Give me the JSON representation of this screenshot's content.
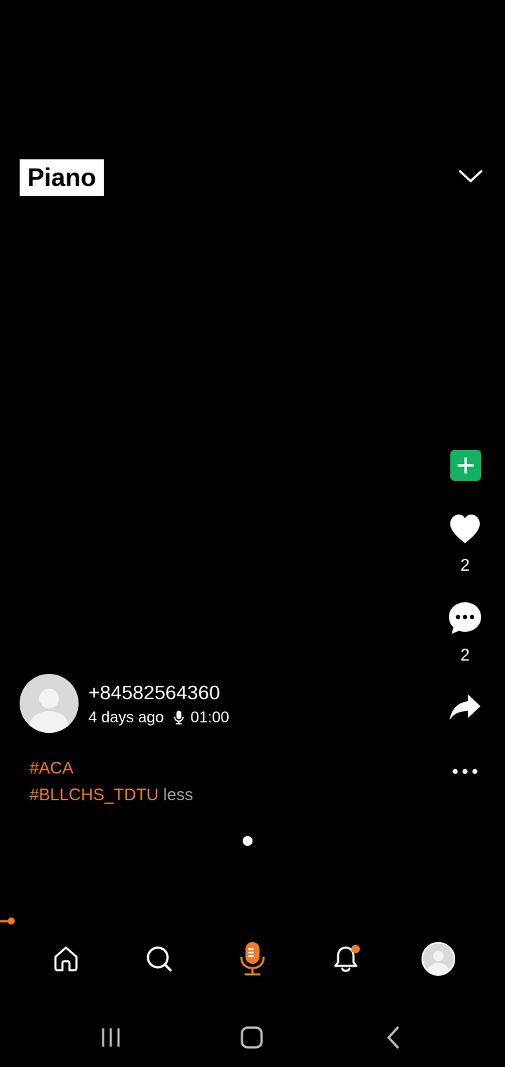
{
  "post": {
    "title": "Piano",
    "author": "+84582564360",
    "posted_ago": "4 days ago",
    "duration": "01:00",
    "tags": [
      "#ACA",
      "#BLLCHS_TDTU"
    ],
    "less_label": "less"
  },
  "actions": {
    "like_count": "2",
    "comment_count": "2"
  },
  "colors": {
    "accent": "#ef7b23",
    "add_button": "#12b163",
    "background": "#000000"
  },
  "icons": {
    "collapse": "chevron-down-icon",
    "add": "plus-icon",
    "like": "heart-icon",
    "comment": "comment-icon",
    "share": "share-icon",
    "more": "more-horizontal-icon",
    "home": "home-icon",
    "search": "search-icon",
    "record": "microphone-icon",
    "notifications": "bell-icon",
    "profile": "avatar",
    "recents": "recents-icon",
    "system_home": "system-home-icon",
    "back": "back-icon"
  }
}
